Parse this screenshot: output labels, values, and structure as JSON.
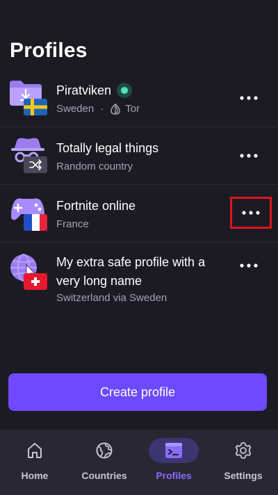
{
  "page": {
    "title": "Profiles"
  },
  "profiles": [
    {
      "name": "Piratviken",
      "country": "Sweden",
      "feature": "Tor",
      "status": "connected",
      "icon": "folder-download-icon",
      "flag": "sweden-flag"
    },
    {
      "name": "Totally legal things",
      "country": "Random country",
      "icon": "incognito-icon",
      "flag": "shuffle-icon"
    },
    {
      "name": "Fortnite online",
      "country": "France",
      "icon": "gamepad-icon",
      "flag": "france-flag"
    },
    {
      "name": "My extra safe profile with a very long name",
      "country": "Switzerland via Sweden",
      "icon": "globe-cursor-icon",
      "flag": "switzerland-flag"
    }
  ],
  "actions": {
    "create_label": "Create profile"
  },
  "nav": [
    {
      "label": "Home",
      "icon": "home-icon"
    },
    {
      "label": "Countries",
      "icon": "globe-icon"
    },
    {
      "label": "Profiles",
      "icon": "terminal-icon",
      "active": true
    },
    {
      "label": "Settings",
      "icon": "gear-icon"
    }
  ],
  "colors": {
    "accent": "#6d4aff",
    "background": "#1c1b24",
    "nav": "#292733",
    "connected": "#4fe3b5"
  }
}
